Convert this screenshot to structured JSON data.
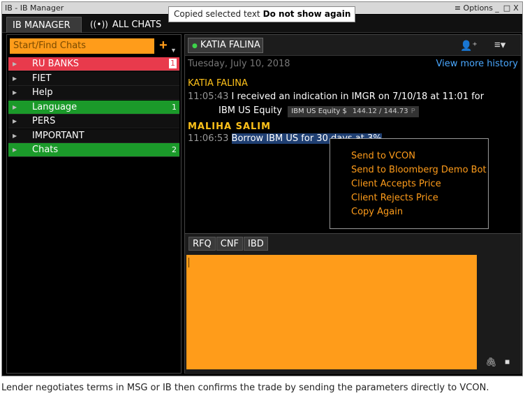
{
  "window": {
    "title": "IB - IB Manager",
    "options_label": "≡ Options",
    "minimize": "_",
    "maximize": "□",
    "close": "X"
  },
  "toast": {
    "text": "Copied selected text",
    "action": "Do not show again"
  },
  "tabs": {
    "ib_manager": "IB MANAGER",
    "all_chats_icon": "((•))",
    "all_chats": "ALL CHATS"
  },
  "left_panel": {
    "search_placeholder": "Start/Find Chats",
    "add_button": "+",
    "groups": [
      {
        "label": "RU BANKS",
        "count": "1",
        "color": "#e83a4c"
      },
      {
        "label": "FIET",
        "count": ""
      },
      {
        "label": "Help",
        "count": ""
      },
      {
        "label": "Language",
        "count": "1",
        "color": "#1b9a2a"
      },
      {
        "label": "PERS",
        "count": ""
      },
      {
        "label": "IMPORTANT",
        "count": ""
      },
      {
        "label": "Chats",
        "count": "2",
        "color": "#1b9a2a"
      }
    ]
  },
  "chat": {
    "title": "KATIA FALINA",
    "date": "Tuesday, July 10, 2018",
    "view_history": "View more history",
    "messages": [
      {
        "sender": "KATIA FALINA",
        "time": "11:05:43",
        "text": "I received an indication in IMGR on 7/10/18 at 11:01 for",
        "text_cont": "IBM US Equity",
        "tag": {
          "ticker": "IBM  US Equity $",
          "price": "144.12 / 144.73",
          "flag": "P"
        }
      },
      {
        "sender": "MALIHA SALIM",
        "time": "11:06:53",
        "text": "Borrow IBM US for 30 days at 3%"
      }
    ]
  },
  "context_menu": {
    "items": [
      "Send to VCON",
      "Send to Bloomberg Demo Bot",
      "Client Accepts Price",
      "Client Rejects Price",
      "Copy Again"
    ]
  },
  "compose": {
    "tabs": [
      "RFQ",
      "CNF",
      "IBD"
    ]
  },
  "caption": "Lender negotiates terms in MSG or IB then confirms the trade by sending the parameters directly to VCON.",
  "colors": {
    "accent_orange": "#ff9c1a",
    "sender_yellow": "#ffc21a",
    "link_blue": "#4aa8ff",
    "red_group": "#e83a4c",
    "green_group": "#1b9a2a"
  }
}
